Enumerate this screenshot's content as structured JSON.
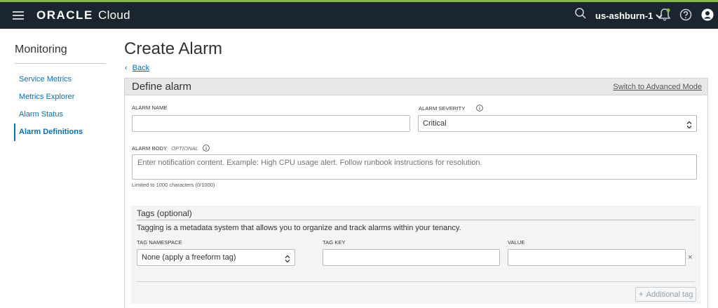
{
  "topbar": {
    "brand": "ORACLE",
    "product": "Cloud",
    "region": "us-ashburn-1"
  },
  "sidebar": {
    "title": "Monitoring",
    "items": [
      {
        "label": "Service Metrics"
      },
      {
        "label": "Metrics Explorer"
      },
      {
        "label": "Alarm Status"
      },
      {
        "label": "Alarm Definitions",
        "active": true
      }
    ]
  },
  "page": {
    "title": "Create Alarm",
    "back_label": "Back"
  },
  "define_alarm": {
    "title": "Define alarm",
    "advanced_link": "Switch to Advanced Mode",
    "alarm_name_label": "ALARM NAME",
    "alarm_name_value": "",
    "alarm_severity_label": "ALARM SEVERITY",
    "alarm_severity_value": "Critical",
    "alarm_body_label": "ALARM BODY",
    "alarm_body_optional": "OPTIONAL",
    "alarm_body_placeholder": "Enter notification content. Example: High CPU usage alert. Follow runbook instructions for resolution.",
    "char_limit": "Limited to 1000 characters (0/1000)"
  },
  "tags": {
    "title": "Tags (optional)",
    "description": "Tagging is a metadata system that allows you to organize and track alarms within your tenancy.",
    "namespace_label": "TAG NAMESPACE",
    "namespace_value": "None (apply a freeform tag)",
    "key_label": "TAG KEY",
    "key_value": "",
    "value_label": "VALUE",
    "value_value": "",
    "remove": "×",
    "add_tag_label": "Additional tag"
  },
  "colors": {
    "topbar": "#1b2530",
    "accent": "#0a6fb0",
    "topbar_stripe": "#86b74f"
  }
}
